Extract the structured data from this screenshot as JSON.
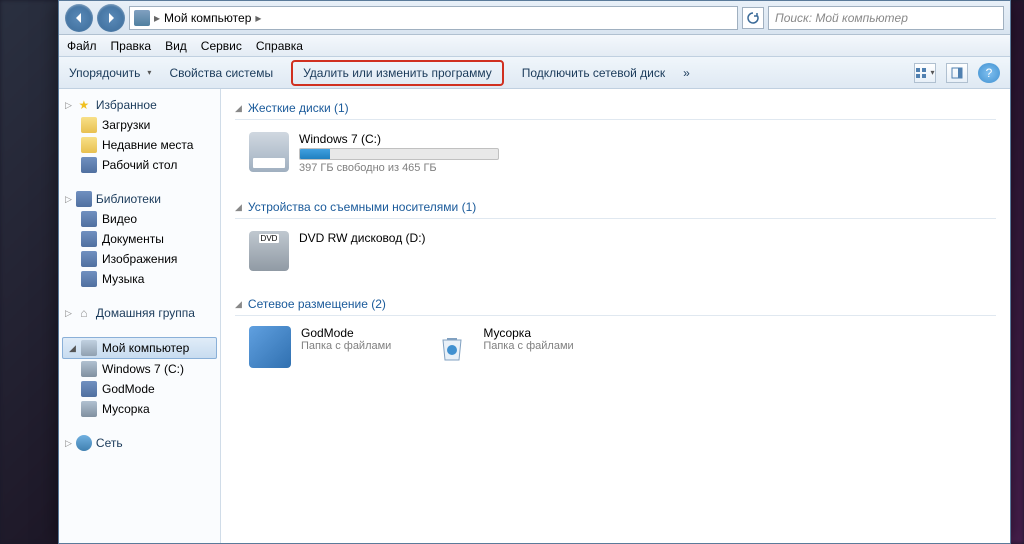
{
  "titlebar": {
    "minimize": "_",
    "maximize": "□",
    "close": "✕"
  },
  "nav": {
    "breadcrumb_root": "Мой компьютер",
    "search_placeholder": "Поиск: Мой компьютер"
  },
  "menubar": [
    "Файл",
    "Правка",
    "Вид",
    "Сервис",
    "Справка"
  ],
  "toolbar": {
    "organize": "Упорядочить",
    "sys_props": "Свойства системы",
    "uninstall": "Удалить или изменить программу",
    "map_drive": "Подключить сетевой диск",
    "more": "»"
  },
  "sidebar": {
    "favorites": {
      "label": "Избранное",
      "items": [
        "Загрузки",
        "Недавние места",
        "Рабочий стол"
      ]
    },
    "libraries": {
      "label": "Библиотеки",
      "items": [
        "Видео",
        "Документы",
        "Изображения",
        "Музыка"
      ]
    },
    "homegroup": {
      "label": "Домашняя группа"
    },
    "computer": {
      "label": "Мой компьютер",
      "items": [
        "Windows 7 (C:)",
        "GodMode",
        "Мусорка"
      ]
    },
    "network": {
      "label": "Сеть"
    }
  },
  "content": {
    "hard_drives": {
      "title": "Жесткие диски (1)",
      "drive": {
        "name": "Windows 7 (C:)",
        "free": "397 ГБ свободно из 465 ГБ",
        "fill_pct": 15
      }
    },
    "removable": {
      "title": "Устройства со съемными носителями (1)",
      "device": {
        "name": "DVD RW дисковод (D:)"
      }
    },
    "network_loc": {
      "title": "Сетевое размещение (2)",
      "items": [
        {
          "name": "GodMode",
          "sub": "Папка с файлами"
        },
        {
          "name": "Мусорка",
          "sub": "Папка с файлами"
        }
      ]
    }
  }
}
